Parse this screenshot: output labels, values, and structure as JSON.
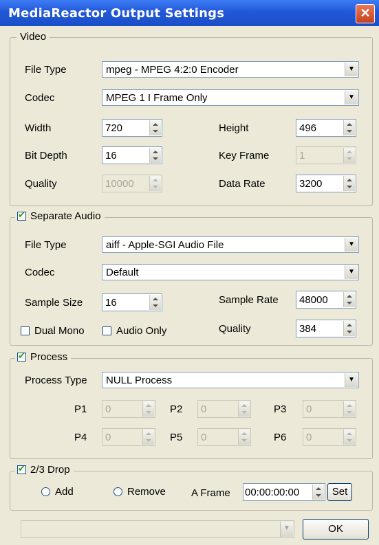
{
  "window": {
    "title": "MediaReactor Output Settings",
    "close_label": "✕"
  },
  "video": {
    "legend": "Video",
    "file_type_label": "File Type",
    "file_type_value": "mpeg - MPEG 4:2:0 Encoder",
    "codec_label": "Codec",
    "codec_value": "MPEG 1 I Frame Only",
    "width_label": "Width",
    "width_value": "720",
    "height_label": "Height",
    "height_value": "496",
    "bit_depth_label": "Bit Depth",
    "bit_depth_value": "16",
    "key_frame_label": "Key Frame",
    "key_frame_value": "1",
    "quality_label": "Quality",
    "quality_value": "10000",
    "data_rate_label": "Data Rate",
    "data_rate_value": "3200"
  },
  "audio": {
    "legend": "Separate Audio",
    "checked": true,
    "file_type_label": "File Type",
    "file_type_value": "aiff - Apple-SGI Audio File",
    "codec_label": "Codec",
    "codec_value": "Default",
    "sample_size_label": "Sample Size",
    "sample_size_value": "16",
    "sample_rate_label": "Sample Rate",
    "sample_rate_value": "48000",
    "dual_mono_label": "Dual Mono",
    "audio_only_label": "Audio Only",
    "quality_label": "Quality",
    "quality_value": "384"
  },
  "process": {
    "legend": "Process",
    "checked": true,
    "type_label": "Process Type",
    "type_value": "NULL Process",
    "params": [
      {
        "label": "P1",
        "value": "0"
      },
      {
        "label": "P2",
        "value": "0"
      },
      {
        "label": "P3",
        "value": "0"
      },
      {
        "label": "P4",
        "value": "0"
      },
      {
        "label": "P5",
        "value": "0"
      },
      {
        "label": "P6",
        "value": "0"
      }
    ]
  },
  "drop": {
    "legend": "2/3 Drop",
    "checked": true,
    "add_label": "Add",
    "remove_label": "Remove",
    "a_frame_label": "A Frame",
    "a_frame_value": "00:00:00:00",
    "set_label": "Set"
  },
  "footer": {
    "preset_value": "",
    "ok_label": "OK"
  },
  "icons": {
    "dropdown": "▼",
    "check": "✔"
  },
  "colors": {
    "titlebar": "#2258d8",
    "close": "#c6411e",
    "dialog_bg": "#ece9d8"
  }
}
